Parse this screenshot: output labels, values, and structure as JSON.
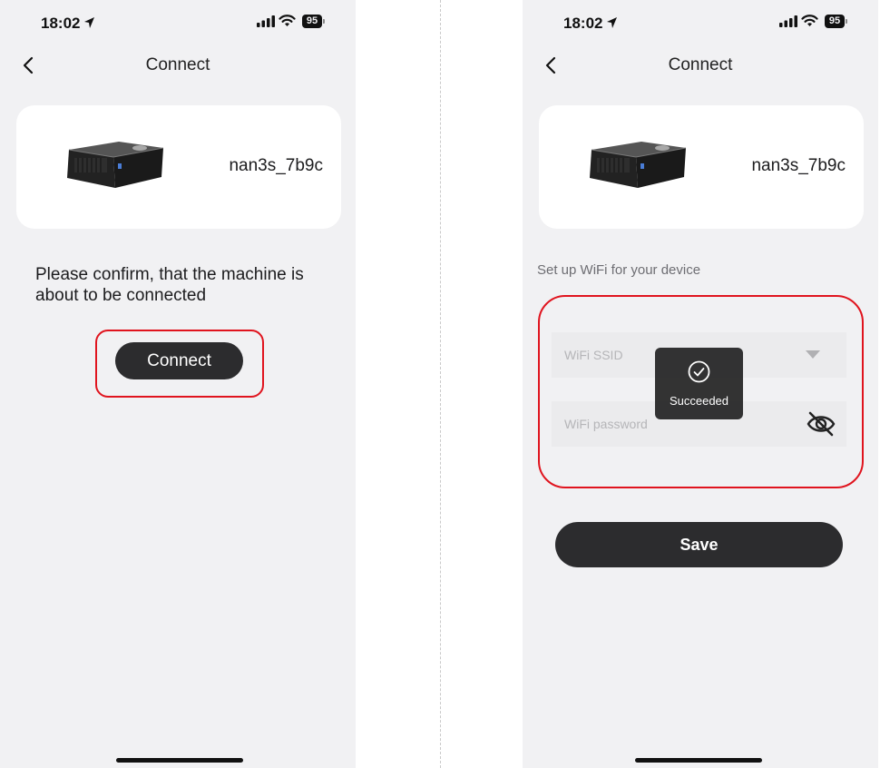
{
  "left_screen": {
    "status_bar": {
      "time": "18:02",
      "battery": "95"
    },
    "nav": {
      "title": "Connect"
    },
    "device": {
      "name": "nan3s_7b9c"
    },
    "confirm_message": "Please confirm, that the machine is about to be connected",
    "connect_button_label": "Connect"
  },
  "right_screen": {
    "status_bar": {
      "time": "18:02",
      "battery": "95"
    },
    "nav": {
      "title": "Connect"
    },
    "device": {
      "name": "nan3s_7b9c"
    },
    "wifi_section_label": "Set up WiFi for your device",
    "ssid_placeholder": "WiFi SSID",
    "password_placeholder": "WiFi password",
    "toast_text": "Succeeded",
    "save_button_label": "Save"
  },
  "colors": {
    "background": "#f1f1f3",
    "card": "#ffffff",
    "button": "#2c2c2e",
    "highlight": "#e0141e"
  }
}
